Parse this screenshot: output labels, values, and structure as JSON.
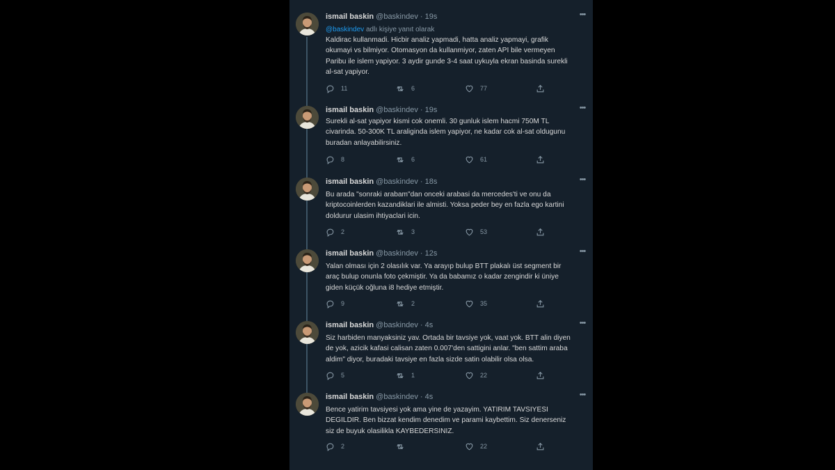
{
  "user": {
    "name": "ismail baskin",
    "handle": "@baskindev"
  },
  "ui": {
    "dot": "·",
    "more_icon": "more-icon"
  },
  "reply_to": {
    "mention": "@baskindev",
    "suffix": "adlı kişiye yanıt olarak"
  },
  "tweets": [
    {
      "time": "19s",
      "lines": [
        "Kaldirac kullanmadi. Hicbir analiz yapmadi, hatta analiz yapmayi, grafik",
        "okumayi vs bilmiyor. Otomasyon da kullanmiyor, zaten API bile vermeyen",
        "Paribu ile islem yapiyor. 3 aydir gunde 3-4 saat uykuyla ekran basinda surekli",
        "al-sat yapiyor."
      ],
      "replies": "11",
      "retweets": "6",
      "likes": "77"
    },
    {
      "time": "19s",
      "lines": [
        "Surekli al-sat yapiyor kismi cok onemli. 30 gunluk islem hacmi 750M TL",
        "civarinda. 50-300K TL araliginda islem yapiyor, ne kadar cok al-sat oldugunu",
        "buradan anlayabilirsiniz."
      ],
      "replies": "8",
      "retweets": "6",
      "likes": "61"
    },
    {
      "time": "18s",
      "lines": [
        "Bu arada \"sonraki arabam\"dan onceki arabasi da mercedes'ti ve onu da",
        "kriptocoinlerden kazandiklari ile almisti. Yoksa peder bey en fazla ego kartini",
        "doldurur ulasim ihtiyaclari icin."
      ],
      "replies": "2",
      "retweets": "3",
      "likes": "53"
    },
    {
      "time": "12s",
      "lines": [
        "Yalan olması için 2 olasılık var. Ya arayıp bulup BTT plakalı üst segment bir",
        "araç bulup onunla foto çekmiştir. Ya da babamız o kadar zengindir ki üniye",
        "giden küçük oğluna i8 hediye etmiştir."
      ],
      "replies": "9",
      "retweets": "2",
      "likes": "35"
    },
    {
      "time": "4s",
      "lines": [
        "Siz harbiden manyaksiniz yav. Ortada bir tavsiye yok, vaat yok. BTT alin diyen",
        "de yok, azicik kafasi calisan zaten 0.007'den sattigini anlar. \"ben sattim araba",
        "aldim\" diyor, buradaki tavsiye en fazla sizde satin olabilir olsa olsa."
      ],
      "replies": "5",
      "retweets": "1",
      "likes": "22"
    },
    {
      "time": "4s",
      "lines": [
        "Bence yatirim tavsiyesi yok ama yine de yazayim. YATIRIM TAVSIYESI",
        "DEGILDIR. Ben bizzat kendim denedim ve parami kaybettim. Siz denerseniz",
        "siz de buyuk olasilikla KAYBEDERSINIZ."
      ],
      "replies": "2",
      "retweets": "",
      "likes": "22"
    }
  ],
  "colors": {
    "background": "#15202b",
    "text": "#d9d9d9",
    "secondary": "#8899a6",
    "link": "#1d9bf0",
    "thread_line": "#3d5466"
  }
}
